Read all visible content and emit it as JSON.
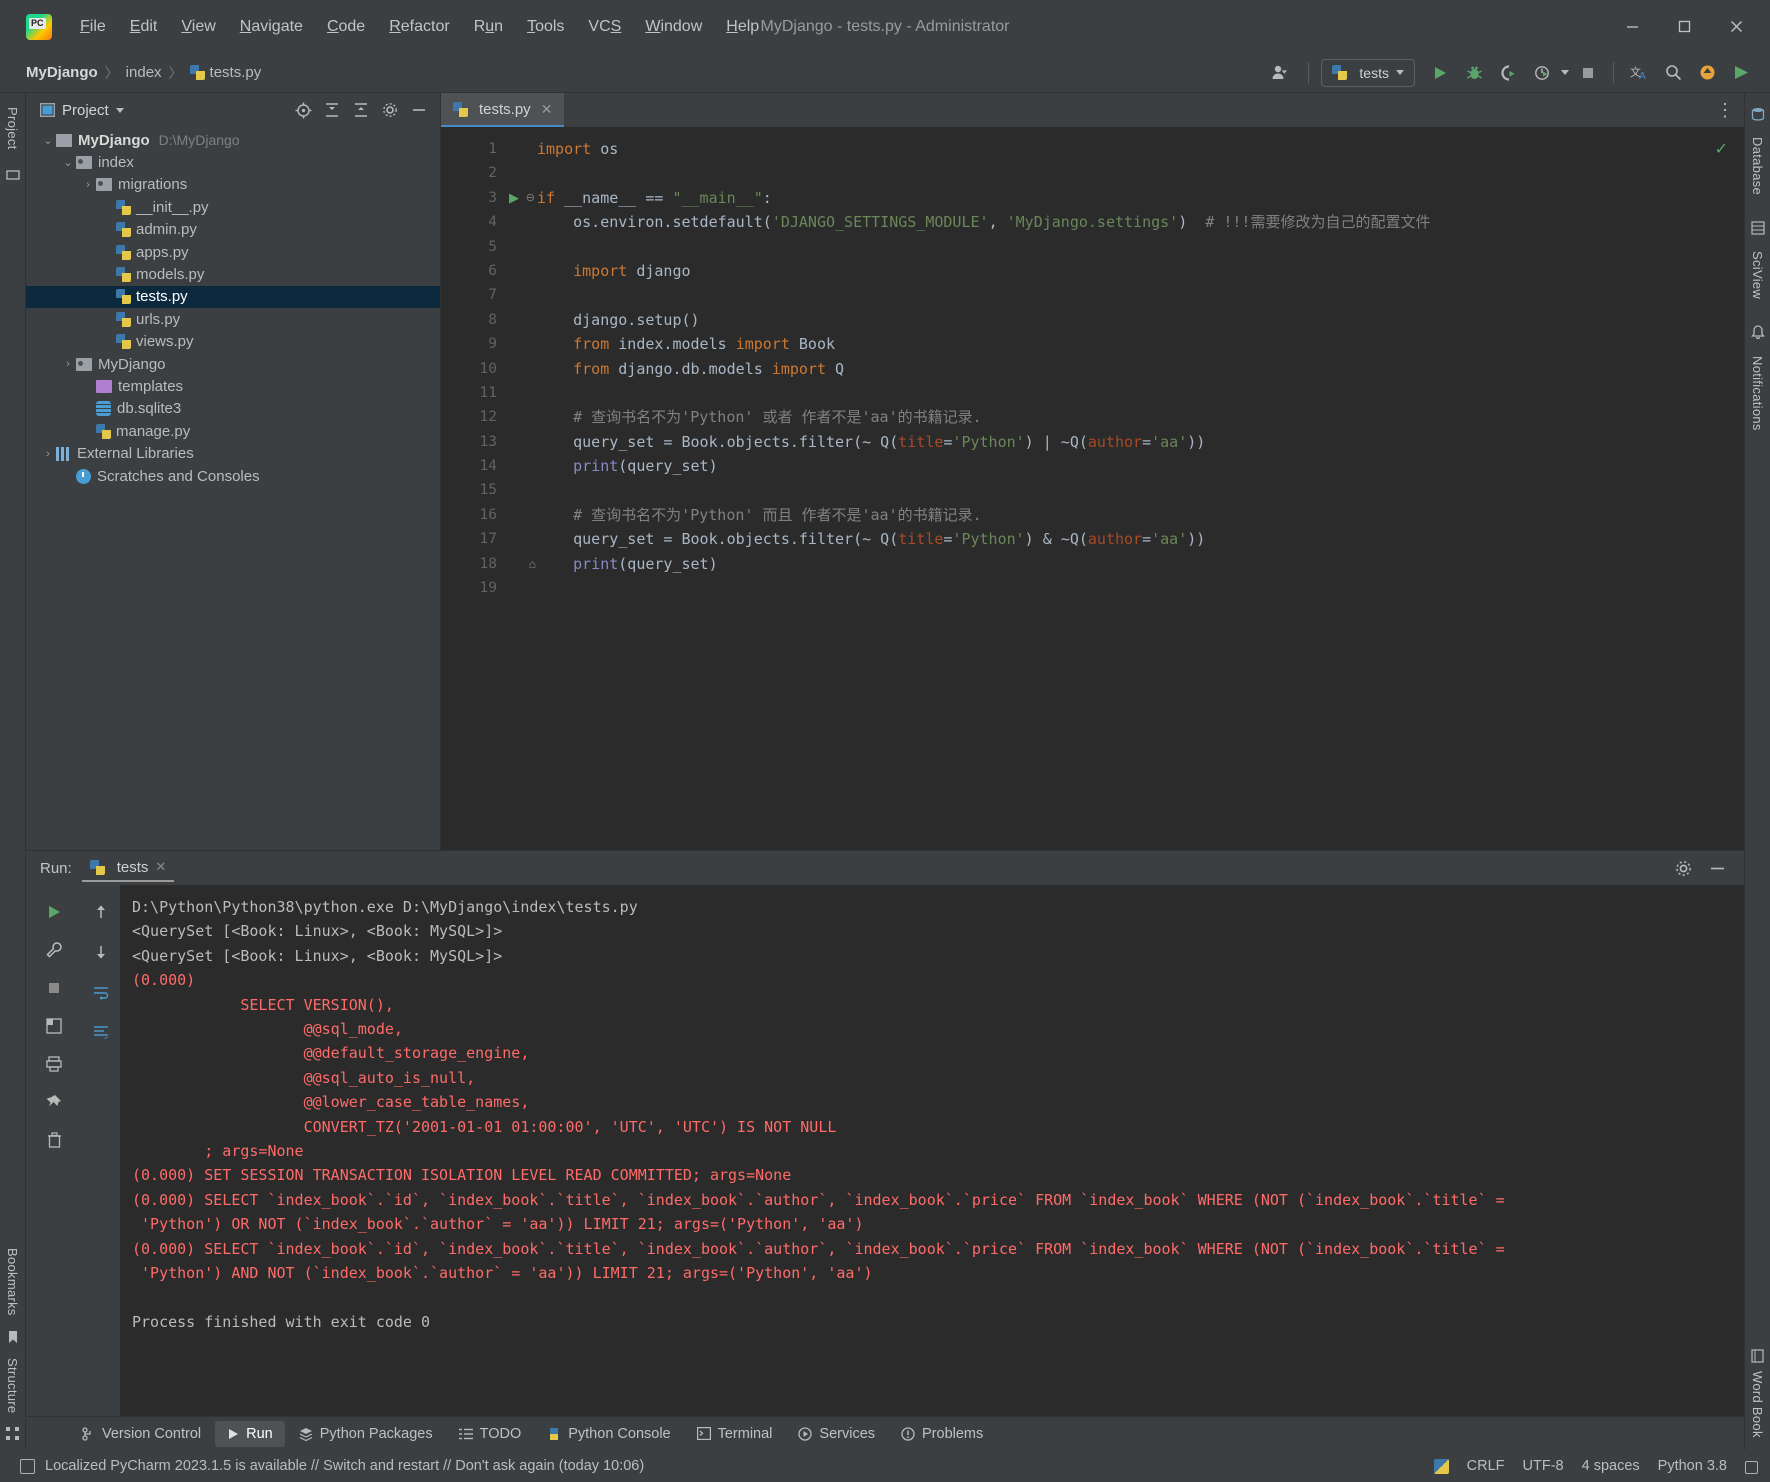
{
  "window": {
    "title": "MyDjango - tests.py - Administrator",
    "minimize": "─",
    "maximize": "☐",
    "close": "✕"
  },
  "menu": [
    {
      "label": "File"
    },
    {
      "label": "Edit"
    },
    {
      "label": "View"
    },
    {
      "label": "Navigate"
    },
    {
      "label": "Code"
    },
    {
      "label": "Refactor"
    },
    {
      "label": "Run"
    },
    {
      "label": "Tools"
    },
    {
      "label": "VCS"
    },
    {
      "label": "Window"
    },
    {
      "label": "Help"
    }
  ],
  "breadcrumb": {
    "project": "MyDjango",
    "folder": "index",
    "file": "tests.py",
    "sep": "〉"
  },
  "toolbar": {
    "run_config": "tests",
    "icons": [
      "user-icon",
      "run-icon",
      "debug-icon",
      "coverage-icon",
      "profile-icon",
      "stop-icon",
      "translate-icon",
      "search-icon",
      "update-icon",
      "plugin-icon"
    ]
  },
  "left_rail": {
    "top_label": "Project",
    "bottom_labels": [
      "Bookmarks",
      "Structure"
    ]
  },
  "right_rail": {
    "labels": [
      "Database",
      "SciView",
      "Notifications",
      "Word Book"
    ]
  },
  "project_panel": {
    "title": "Project",
    "tree": [
      {
        "indent": 0,
        "arrow": "⌄",
        "icon": "folder",
        "label": "MyDjango",
        "bold": true,
        "path": "D:\\MyDjango",
        "selected": false
      },
      {
        "indent": 1,
        "arrow": "⌄",
        "icon": "folder-src",
        "label": "index",
        "bold": false,
        "path": "",
        "selected": false
      },
      {
        "indent": 2,
        "arrow": "›",
        "icon": "folder-src",
        "label": "migrations",
        "bold": false,
        "path": "",
        "selected": false
      },
      {
        "indent": 3,
        "arrow": "",
        "icon": "python",
        "label": "__init__.py",
        "bold": false,
        "path": "",
        "selected": false
      },
      {
        "indent": 3,
        "arrow": "",
        "icon": "python",
        "label": "admin.py",
        "bold": false,
        "path": "",
        "selected": false
      },
      {
        "indent": 3,
        "arrow": "",
        "icon": "python",
        "label": "apps.py",
        "bold": false,
        "path": "",
        "selected": false
      },
      {
        "indent": 3,
        "arrow": "",
        "icon": "python",
        "label": "models.py",
        "bold": false,
        "path": "",
        "selected": false
      },
      {
        "indent": 3,
        "arrow": "",
        "icon": "python",
        "label": "tests.py",
        "bold": false,
        "path": "",
        "selected": true
      },
      {
        "indent": 3,
        "arrow": "",
        "icon": "python",
        "label": "urls.py",
        "bold": false,
        "path": "",
        "selected": false
      },
      {
        "indent": 3,
        "arrow": "",
        "icon": "python",
        "label": "views.py",
        "bold": false,
        "path": "",
        "selected": false
      },
      {
        "indent": 1,
        "arrow": "›",
        "icon": "folder-src",
        "label": "MyDjango",
        "bold": false,
        "path": "",
        "selected": false
      },
      {
        "indent": 2,
        "arrow": "",
        "icon": "folder-tpl",
        "label": "templates",
        "bold": false,
        "path": "",
        "selected": false
      },
      {
        "indent": 2,
        "arrow": "",
        "icon": "db",
        "label": "db.sqlite3",
        "bold": false,
        "path": "",
        "selected": false
      },
      {
        "indent": 2,
        "arrow": "",
        "icon": "python",
        "label": "manage.py",
        "bold": false,
        "path": "",
        "selected": false
      },
      {
        "indent": 0,
        "arrow": "›",
        "icon": "lib",
        "label": "External Libraries",
        "bold": false,
        "path": "",
        "selected": false
      },
      {
        "indent": 1,
        "arrow": "",
        "icon": "scratch",
        "label": "Scratches and Consoles",
        "bold": false,
        "path": "",
        "selected": false
      }
    ]
  },
  "editor": {
    "tab": {
      "label": "tests.py",
      "close": "✕"
    },
    "lines": [
      {
        "n": 1,
        "mark": "",
        "fold": "",
        "tokens": [
          {
            "t": "import",
            "c": "kw"
          },
          {
            "t": " os",
            "c": ""
          }
        ]
      },
      {
        "n": 2,
        "mark": "",
        "fold": "",
        "tokens": []
      },
      {
        "n": 3,
        "mark": "run",
        "fold": "minus",
        "tokens": [
          {
            "t": "if",
            "c": "kw"
          },
          {
            "t": " __name__ == ",
            "c": ""
          },
          {
            "t": "\"__main__\"",
            "c": "str"
          },
          {
            "t": ":",
            "c": ""
          }
        ]
      },
      {
        "n": 4,
        "mark": "",
        "fold": "",
        "tokens": [
          {
            "t": "    os.environ.setdefault(",
            "c": ""
          },
          {
            "t": "'DJANGO_SETTINGS_MODULE'",
            "c": "str"
          },
          {
            "t": ", ",
            "c": ""
          },
          {
            "t": "'MyDjango.settings'",
            "c": "str"
          },
          {
            "t": ")  ",
            "c": ""
          },
          {
            "t": "# !!!需要修改为自己的配置文件",
            "c": "cmt"
          }
        ]
      },
      {
        "n": 5,
        "mark": "",
        "fold": "",
        "tokens": []
      },
      {
        "n": 6,
        "mark": "",
        "fold": "",
        "tokens": [
          {
            "t": "    ",
            "c": ""
          },
          {
            "t": "import",
            "c": "kw"
          },
          {
            "t": " django",
            "c": ""
          }
        ]
      },
      {
        "n": 7,
        "mark": "",
        "fold": "",
        "tokens": []
      },
      {
        "n": 8,
        "mark": "",
        "fold": "",
        "tokens": [
          {
            "t": "    django.setup()",
            "c": ""
          }
        ]
      },
      {
        "n": 9,
        "mark": "",
        "fold": "",
        "tokens": [
          {
            "t": "    ",
            "c": ""
          },
          {
            "t": "from",
            "c": "kw"
          },
          {
            "t": " index.models ",
            "c": ""
          },
          {
            "t": "import",
            "c": "kw"
          },
          {
            "t": " Book",
            "c": ""
          }
        ]
      },
      {
        "n": 10,
        "mark": "",
        "fold": "",
        "tokens": [
          {
            "t": "    ",
            "c": ""
          },
          {
            "t": "from",
            "c": "kw"
          },
          {
            "t": " django.db.models ",
            "c": ""
          },
          {
            "t": "import",
            "c": "kw"
          },
          {
            "t": " Q",
            "c": ""
          }
        ]
      },
      {
        "n": 11,
        "mark": "",
        "fold": "",
        "tokens": []
      },
      {
        "n": 12,
        "mark": "",
        "fold": "",
        "tokens": [
          {
            "t": "    ",
            "c": ""
          },
          {
            "t": "# 查询书名不为'Python' 或者 作者不是'aa'的书籍记录.",
            "c": "cmt"
          }
        ]
      },
      {
        "n": 13,
        "mark": "",
        "fold": "",
        "tokens": [
          {
            "t": "    query_set = Book.objects.filter(~ Q(",
            "c": ""
          },
          {
            "t": "title",
            "c": "param"
          },
          {
            "t": "=",
            "c": ""
          },
          {
            "t": "'Python'",
            "c": "str"
          },
          {
            "t": ") | ~Q(",
            "c": ""
          },
          {
            "t": "author",
            "c": "param"
          },
          {
            "t": "=",
            "c": ""
          },
          {
            "t": "'aa'",
            "c": "str"
          },
          {
            "t": "))",
            "c": ""
          }
        ]
      },
      {
        "n": 14,
        "mark": "",
        "fold": "",
        "tokens": [
          {
            "t": "    ",
            "c": ""
          },
          {
            "t": "print",
            "c": "pfn"
          },
          {
            "t": "(query_set)",
            "c": ""
          }
        ]
      },
      {
        "n": 15,
        "mark": "",
        "fold": "",
        "tokens": []
      },
      {
        "n": 16,
        "mark": "",
        "fold": "",
        "tokens": [
          {
            "t": "    ",
            "c": ""
          },
          {
            "t": "# 查询书名不为'Python' 而且 作者不是'aa'的书籍记录.",
            "c": "cmt"
          }
        ]
      },
      {
        "n": 17,
        "mark": "",
        "fold": "",
        "tokens": [
          {
            "t": "    query_set = Book.objects.filter(~ Q(",
            "c": ""
          },
          {
            "t": "title",
            "c": "param"
          },
          {
            "t": "=",
            "c": ""
          },
          {
            "t": "'Python'",
            "c": "str"
          },
          {
            "t": ") & ~Q(",
            "c": ""
          },
          {
            "t": "author",
            "c": "param"
          },
          {
            "t": "=",
            "c": ""
          },
          {
            "t": "'aa'",
            "c": "str"
          },
          {
            "t": "))",
            "c": ""
          }
        ]
      },
      {
        "n": 18,
        "mark": "lock",
        "fold": "",
        "tokens": [
          {
            "t": "    ",
            "c": ""
          },
          {
            "t": "print",
            "c": "pfn"
          },
          {
            "t": "(query_set)",
            "c": ""
          }
        ]
      },
      {
        "n": 19,
        "mark": "",
        "fold": "",
        "tokens": []
      }
    ],
    "inspection_status": "✓"
  },
  "run_panel": {
    "label": "Run:",
    "tab": "tests",
    "tab_close": "✕",
    "console": [
      {
        "text": "D:\\Python\\Python38\\python.exe D:\\MyDjango\\index\\tests.py",
        "cls": "c-out"
      },
      {
        "text": "<QuerySet [<Book: Linux>, <Book: MySQL>]>",
        "cls": "c-out"
      },
      {
        "text": "<QuerySet [<Book: Linux>, <Book: MySQL>]>",
        "cls": "c-out"
      },
      {
        "text": "(0.000)",
        "cls": "c-err"
      },
      {
        "text": "            SELECT VERSION(),",
        "cls": "c-err"
      },
      {
        "text": "                   @@sql_mode,",
        "cls": "c-err"
      },
      {
        "text": "                   @@default_storage_engine,",
        "cls": "c-err"
      },
      {
        "text": "                   @@sql_auto_is_null,",
        "cls": "c-err"
      },
      {
        "text": "                   @@lower_case_table_names,",
        "cls": "c-err"
      },
      {
        "text": "                   CONVERT_TZ('2001-01-01 01:00:00', 'UTC', 'UTC') IS NOT NULL",
        "cls": "c-err"
      },
      {
        "text": "        ; args=None",
        "cls": "c-err"
      },
      {
        "text": "(0.000) SET SESSION TRANSACTION ISOLATION LEVEL READ COMMITTED; args=None",
        "cls": "c-err"
      },
      {
        "text": "(0.000) SELECT `index_book`.`id`, `index_book`.`title`, `index_book`.`author`, `index_book`.`price` FROM `index_book` WHERE (NOT (`index_book`.`title` =",
        "cls": "c-err"
      },
      {
        "text": " 'Python') OR NOT (`index_book`.`author` = 'aa')) LIMIT 21; args=('Python', 'aa')",
        "cls": "c-err"
      },
      {
        "text": "(0.000) SELECT `index_book`.`id`, `index_book`.`title`, `index_book`.`author`, `index_book`.`price` FROM `index_book` WHERE (NOT (`index_book`.`title` =",
        "cls": "c-err"
      },
      {
        "text": " 'Python') AND NOT (`index_book`.`author` = 'aa')) LIMIT 21; args=('Python', 'aa')",
        "cls": "c-err"
      },
      {
        "text": "",
        "cls": "c-out"
      },
      {
        "text": "Process finished with exit code 0",
        "cls": "c-out"
      }
    ]
  },
  "bottom_tabs": [
    {
      "label": "Version Control",
      "icon": "branch-icon",
      "active": false
    },
    {
      "label": "Run",
      "icon": "run-icon",
      "active": true
    },
    {
      "label": "Python Packages",
      "icon": "packages-icon",
      "active": false
    },
    {
      "label": "TODO",
      "icon": "list-icon",
      "active": false
    },
    {
      "label": "Python Console",
      "icon": "python-icon",
      "active": false
    },
    {
      "label": "Terminal",
      "icon": "terminal-icon",
      "active": false
    },
    {
      "label": "Services",
      "icon": "services-icon",
      "active": false
    },
    {
      "label": "Problems",
      "icon": "problems-icon",
      "active": false
    }
  ],
  "statusbar": {
    "message": "Localized PyCharm 2023.1.5 is available // Switch and restart // Don't ask again (today 10:06)",
    "line_sep": "CRLF",
    "encoding": "UTF-8",
    "indent": "4 spaces",
    "interpreter": "Python 3.8"
  },
  "colors": {
    "chrome": "#3c3f41",
    "editor_bg": "#2b2b2b",
    "selection": "#0d293e",
    "accent": "#4a88c7",
    "error_text": "#ff6b68",
    "green": "#59a869"
  }
}
